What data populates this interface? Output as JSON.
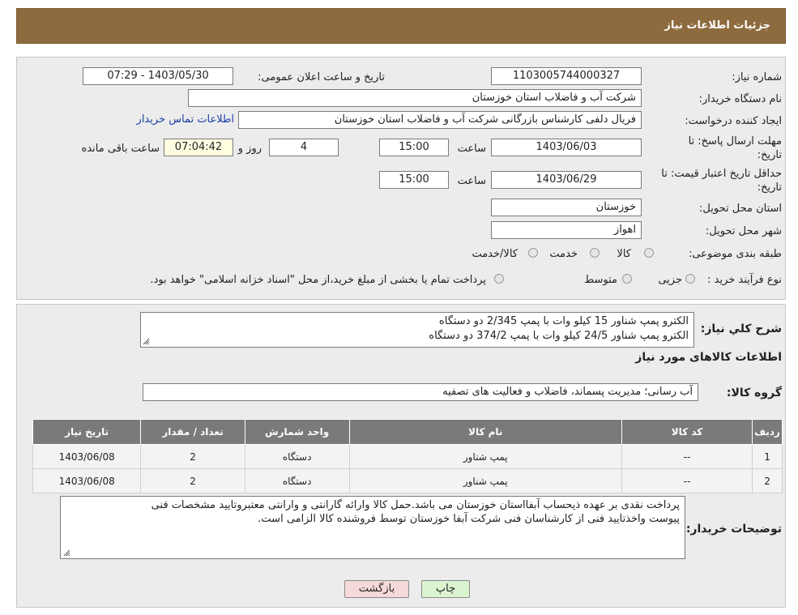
{
  "header": {
    "title": "جزئیات اطلاعات نیاز"
  },
  "form": {
    "need_number_label": "شماره نیاز:",
    "need_number": "1103005744000327",
    "announce_label": "تاریخ و ساعت اعلان عمومی:",
    "announce_value": "1403/05/30 - 07:29",
    "buyer_org_label": "نام دستگاه خریدار:",
    "buyer_org": "شرکت آب و فاضلاب استان خوزستان",
    "creator_label": "ایجاد کننده درخواست:",
    "creator": "فریال دلفی کارشناس بازرگانی شرکت آب و فاضلاب استان خوزستان",
    "contact_link": "اطلاعات تماس خریدار",
    "reply_deadline_label_1": "مهلت ارسال پاسخ: تا",
    "reply_deadline_label_2": "تاریخ:",
    "reply_date": "1403/06/03",
    "time_label": "ساعت",
    "reply_time": "15:00",
    "days_value": "4",
    "days_label": "روز و",
    "remaining_value": "07:04:42",
    "remaining_label": "ساعت باقی مانده",
    "validity_label_1": "حداقل تاریخ اعتبار قیمت: تا",
    "validity_label_2": "تاریخ:",
    "validity_date": "1403/06/29",
    "validity_time": "15:00",
    "province_label": "استان محل تحویل:",
    "province": "خوزستان",
    "city_label": "شهر محل تحویل:",
    "city": "اهواز",
    "category_label": "طبقه بندی موضوعی:",
    "category_options": [
      "کالا",
      "خدمت",
      "کالا/خدمت"
    ],
    "process_label": "نوع فرآیند خرید :",
    "process_options": [
      "جزیی",
      "متوسط"
    ],
    "process_note": "پرداخت تمام یا بخشی از مبلغ خرید،از محل \"اسناد خزانه اسلامی\" خواهد بود."
  },
  "summary": {
    "label": "شرح کلي نياز:",
    "lines": [
      "الکترو پمپ شناور 15 کیلو وات با پمپ 2/345 دو دستگاه",
      "الکترو پمپ شناور 24/5 کیلو وات با پمپ 374/2 دو دستگاه"
    ],
    "goods_info_title": "اطلاعات کالاهای مورد نیاز",
    "goods_group_label": "گروه کالا:",
    "goods_group": "آب رسانی؛ مدیریت پسماند، فاضلاب و فعالیت های تصفیه"
  },
  "table": {
    "headers": [
      "ردیف",
      "کد کالا",
      "نام کالا",
      "واحد شمارش",
      "تعداد / مقدار",
      "تاریخ نیاز"
    ],
    "rows": [
      [
        "1",
        "--",
        "پمپ شناور",
        "دستگاه",
        "2",
        "1403/06/08"
      ],
      [
        "2",
        "--",
        "پمپ شناور",
        "دستگاه",
        "2",
        "1403/06/08"
      ]
    ]
  },
  "buyer_notes": {
    "label": "توضیحات خریدار:",
    "lines": [
      "پرداخت نقدی بر عهده ذیحساب آبفااستان خوزستان می باشد.حمل کالا وارائه گارانتی و وارانتی معتبروتایید مشخصات فنی",
      "پیوست واخذتایید فنی از کارشناسان فنی شرکت آبفا خوزستان توسط فروشنده کالا الزامی است."
    ]
  },
  "buttons": {
    "print": "چاپ",
    "back": "بازگشت"
  },
  "colors": {
    "header_bg": "#8e6b3f",
    "panel_bg": "#ececec",
    "link": "#1c3ea8",
    "back_button_bg": "#f6d9d9",
    "print_button_bg": "#dcf3d0"
  }
}
